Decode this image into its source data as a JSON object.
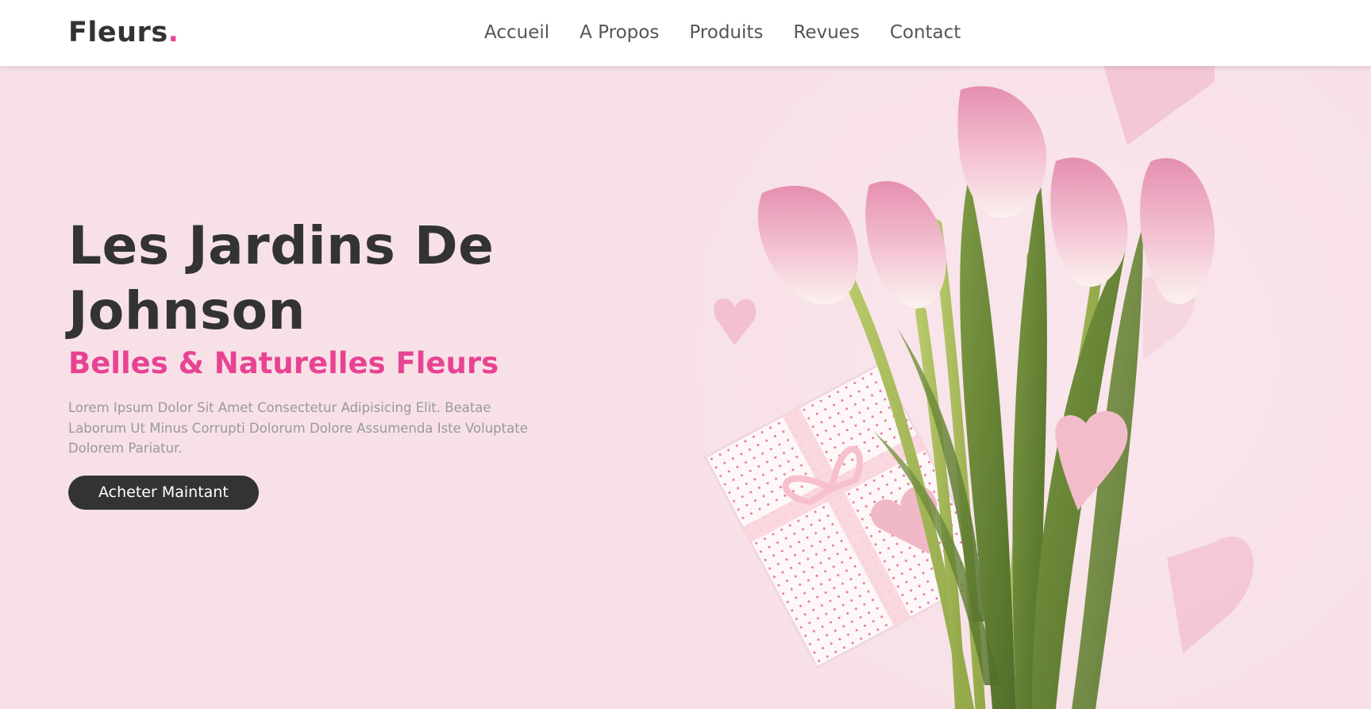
{
  "header": {
    "logo_text": "Fleurs",
    "logo_dot": ".",
    "nav": [
      {
        "label": "Accueil"
      },
      {
        "label": "A Propos"
      },
      {
        "label": "Produits"
      },
      {
        "label": "Revues"
      },
      {
        "label": "Contact"
      }
    ]
  },
  "hero": {
    "title_line1": "Les Jardins De",
    "title_line2": "Johnson",
    "subtitle": "Belles & Naturelles Fleurs",
    "description": "Lorem Ipsum Dolor Sit Amet Consectetur Adipisicing Elit. Beatae Laborum Ut Minus Corrupti Dolorum Dolore Assumenda Iste Voluptate Dolorem Pariatur.",
    "cta_label": "Acheter Maintant",
    "image": "tulip-bouquet-with-gift-box-and-paper-hearts"
  },
  "colors": {
    "accent": "#e84393",
    "dark": "#333333",
    "hero_bg": "#f7e1e7",
    "muted_text": "#999999"
  }
}
